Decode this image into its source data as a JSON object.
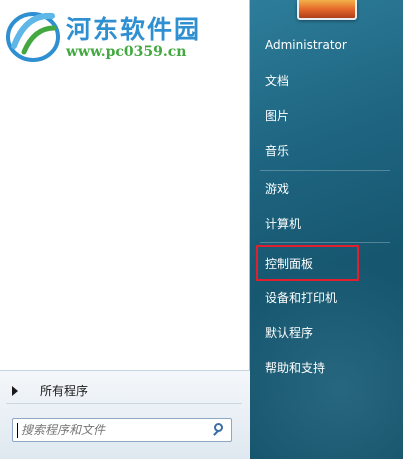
{
  "watermark": {
    "title": "河东软件园",
    "url": "www.pc0359.cn"
  },
  "left_pane": {
    "all_programs_label": "所有程序",
    "search": {
      "placeholder": "搜索程序和文件",
      "icon": "search-icon"
    }
  },
  "right_pane": {
    "user_picture": "user-avatar",
    "items": [
      {
        "label": "Administrator"
      },
      {
        "label": "文档"
      },
      {
        "label": "图片"
      },
      {
        "label": "音乐"
      },
      {
        "label": "游戏"
      },
      {
        "label": "计算机"
      },
      {
        "label": "控制面板"
      },
      {
        "label": "设备和打印机"
      },
      {
        "label": "默认程序"
      },
      {
        "label": "帮助和支持"
      }
    ],
    "highlighted_item": "控制面板"
  },
  "colors": {
    "right_pane": "#1f6682",
    "highlight_box": "#e0202f",
    "watermark_title": "#2e8fd1",
    "watermark_url": "#43a83f"
  }
}
